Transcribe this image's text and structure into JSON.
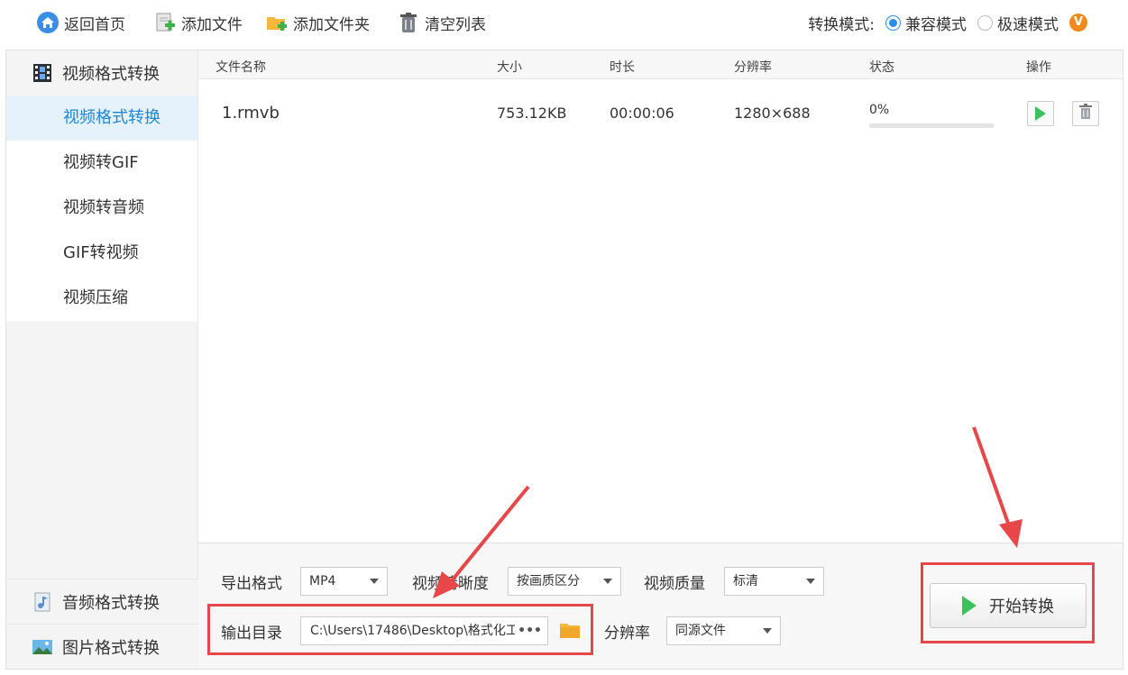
{
  "toolbar": {
    "home": "返回首页",
    "add_file": "添加文件",
    "add_folder": "添加文件夹",
    "clear_list": "清空列表",
    "mode_label": "转换模式:",
    "mode_compatible": "兼容模式",
    "mode_fast": "极速模式",
    "vip_badge": "V"
  },
  "sidebar": {
    "video_header": "视频格式转换",
    "items": [
      {
        "label": "视频格式转换",
        "active": true
      },
      {
        "label": "视频转GIF",
        "active": false
      },
      {
        "label": "视频转音频",
        "active": false
      },
      {
        "label": "GIF转视频",
        "active": false
      },
      {
        "label": "视频压缩",
        "active": false
      }
    ],
    "audio_header": "音频格式转换",
    "image_header": "图片格式转换"
  },
  "table": {
    "headers": {
      "name": "文件名称",
      "size": "大小",
      "duration": "时长",
      "resolution": "分辨率",
      "status": "状态",
      "actions": "操作"
    },
    "rows": [
      {
        "name": "1.rmvb",
        "size": "753.12KB",
        "duration": "00:00:06",
        "resolution": "1280×688",
        "status": "0%",
        "progress": 0
      }
    ]
  },
  "panel": {
    "export_format_label": "导出格式",
    "export_format_value": "MP4",
    "clarity_label": "视频清晰度",
    "clarity_value": "按画质区分",
    "quality_label": "视频质量",
    "quality_value": "标清",
    "output_dir_label": "输出目录",
    "output_dir_value": "C:\\Users\\17486\\Desktop\\格式化工",
    "output_dir_more": "•••",
    "resolution_label": "分辨率",
    "resolution_value": "同源文件",
    "start_button": "开始转换"
  },
  "colors": {
    "accent": "#2d8de8",
    "active_bg": "#e5f1fb",
    "highlight_red": "#e8474a",
    "play_green": "#3cc25a",
    "vip_orange": "#f08a1c"
  }
}
